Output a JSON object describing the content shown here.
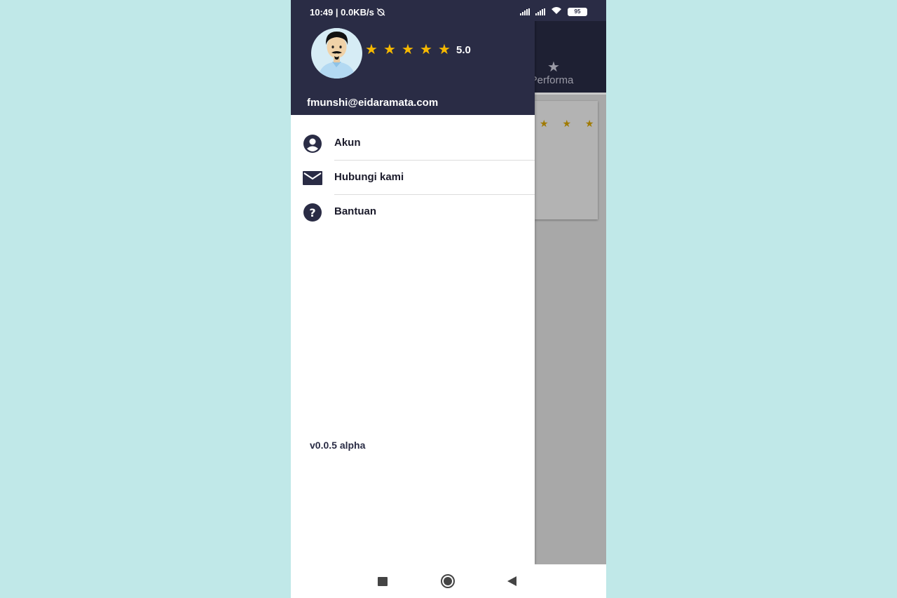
{
  "status_bar": {
    "time_speed": "10:49 | 0.0KB/s",
    "battery": "95"
  },
  "background_app": {
    "tab_icon": "star-icon",
    "tab_label": "Performa",
    "card_stars": "★ ★ ★"
  },
  "drawer": {
    "rating_stars": [
      "★",
      "★",
      "★",
      "★",
      "★"
    ],
    "rating_value": "5.0",
    "email": "fmunshi@eidaramata.com",
    "menu": [
      {
        "label": "Akun",
        "icon": "account-circle-icon"
      },
      {
        "label": "Hubungi kami",
        "icon": "mail-icon"
      },
      {
        "label": "Bantuan",
        "icon": "help-circle-icon"
      }
    ],
    "version": "v0.0.5 alpha"
  },
  "colors": {
    "drawer_header": "#2a2c45",
    "star": "#f5b800",
    "page_bg": "#c0e8e8"
  }
}
